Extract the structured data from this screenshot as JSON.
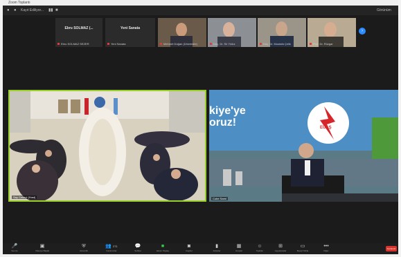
{
  "window": {
    "title": "Zoom Toplantı"
  },
  "toolbar": {
    "left_label": "Kayıt Ediliyor...",
    "right_label": "Görünüm"
  },
  "participants": [
    {
      "name": "Ebru SOLMAZ (...",
      "label": "Ebru SOLMAZ SEZER"
    },
    {
      "name": "Yeni Sanata",
      "label": "Yeni Sanata"
    },
    {
      "name": "",
      "label": "Mehmet Doğan (Üniversite)"
    },
    {
      "name": "",
      "label": "Doç. Dr. Sir Yıldız"
    },
    {
      "name": "",
      "label": "Doç. Dr. Mustafa Çelik"
    },
    {
      "name": "",
      "label": "Prof. Dr. Rüzgar"
    }
  ],
  "main_left": {
    "label": "Say Cekeçi (Host)"
  },
  "main_right": {
    "banner_text": "kiye'ye\noruz!",
    "logo_text": "EÜAŞ",
    "label": "Cube Sami"
  },
  "toolbar_bottom": [
    {
      "icon": "mic",
      "label": "Ses Aç"
    },
    {
      "icon": "video",
      "label": "Videoyu Başlat"
    },
    {
      "icon": "security",
      "label": "Güvenlik"
    },
    {
      "icon": "participants",
      "label": "Katılımcılar",
      "count": "271"
    },
    {
      "icon": "chat",
      "label": "Sohbet"
    },
    {
      "icon": "share",
      "label": "Ekran Paylaş"
    },
    {
      "icon": "record",
      "label": "Kaydet"
    },
    {
      "icon": "polls",
      "label": "Anketler"
    },
    {
      "icon": "breakout",
      "label": "Gruplar"
    },
    {
      "icon": "reactions",
      "label": "Tepkiler"
    },
    {
      "icon": "apps",
      "label": "Uygulamalar"
    },
    {
      "icon": "whiteboard",
      "label": "Beyaz Tahta"
    },
    {
      "icon": "more",
      "label": "Diğer"
    }
  ],
  "end_button": "Sonlandır"
}
